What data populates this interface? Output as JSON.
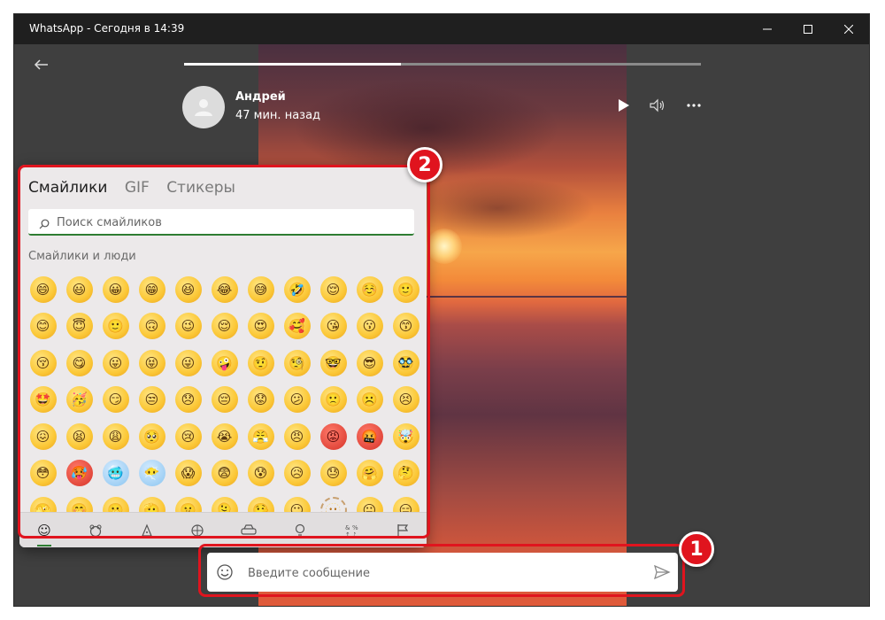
{
  "window": {
    "title": "WhatsApp - Сегодня в 14:39"
  },
  "status_viewer": {
    "contact_name": "Андрей",
    "posted_time": "47 мин. назад",
    "progress": 0.42
  },
  "emoji_picker": {
    "tabs": [
      {
        "label": "Смайлики",
        "active": true
      },
      {
        "label": "GIF",
        "active": false
      },
      {
        "label": "Стикеры",
        "active": false
      }
    ],
    "search_placeholder": "Поиск смайликов",
    "category_title": "Смайлики и люди",
    "accent_color": "#2e7d32",
    "categories": [
      "smiley-icon",
      "animal-icon",
      "food-icon",
      "sport-icon",
      "car-icon",
      "lightbulb-icon",
      "symbols-icon",
      "flag-icon"
    ],
    "emojis": [
      "😄",
      "😃",
      "😀",
      "😁",
      "😆",
      "😂",
      "😅",
      "🤣",
      "😌",
      "☺️",
      "🙂",
      "😊",
      "😇",
      "🙂",
      "🙃",
      "😉",
      "😌",
      "😍",
      "🥰",
      "😘",
      "😗",
      "😙",
      "😚",
      "😋",
      "😛",
      "😝",
      "😜",
      "🤪",
      "🤨",
      "🧐",
      "🤓",
      "😎",
      "🥸",
      "🤩",
      "🥳",
      "😏",
      "😒",
      "😞",
      "😔",
      "😟",
      "😕",
      "🙁",
      "☹️",
      "😣",
      "😖",
      "😫",
      "😩",
      "🥺",
      "😢",
      "😭",
      "😤",
      "😠",
      "😡",
      "🤬",
      "🤯",
      "😳",
      "🥵",
      "🥶",
      "😶‍🌫️",
      "😱",
      "😨",
      "😰",
      "😥",
      "😓",
      "🤗",
      "🤔",
      "🫣",
      "🤭",
      "🫢",
      "🫡",
      "🤫",
      "🫠",
      "🤥",
      "😶",
      "🫥",
      "😐",
      "😑"
    ]
  },
  "composer": {
    "placeholder": "Введите сообщение"
  },
  "annotations": {
    "badge1": "1",
    "badge2": "2",
    "highlight_color": "#e0141e"
  }
}
